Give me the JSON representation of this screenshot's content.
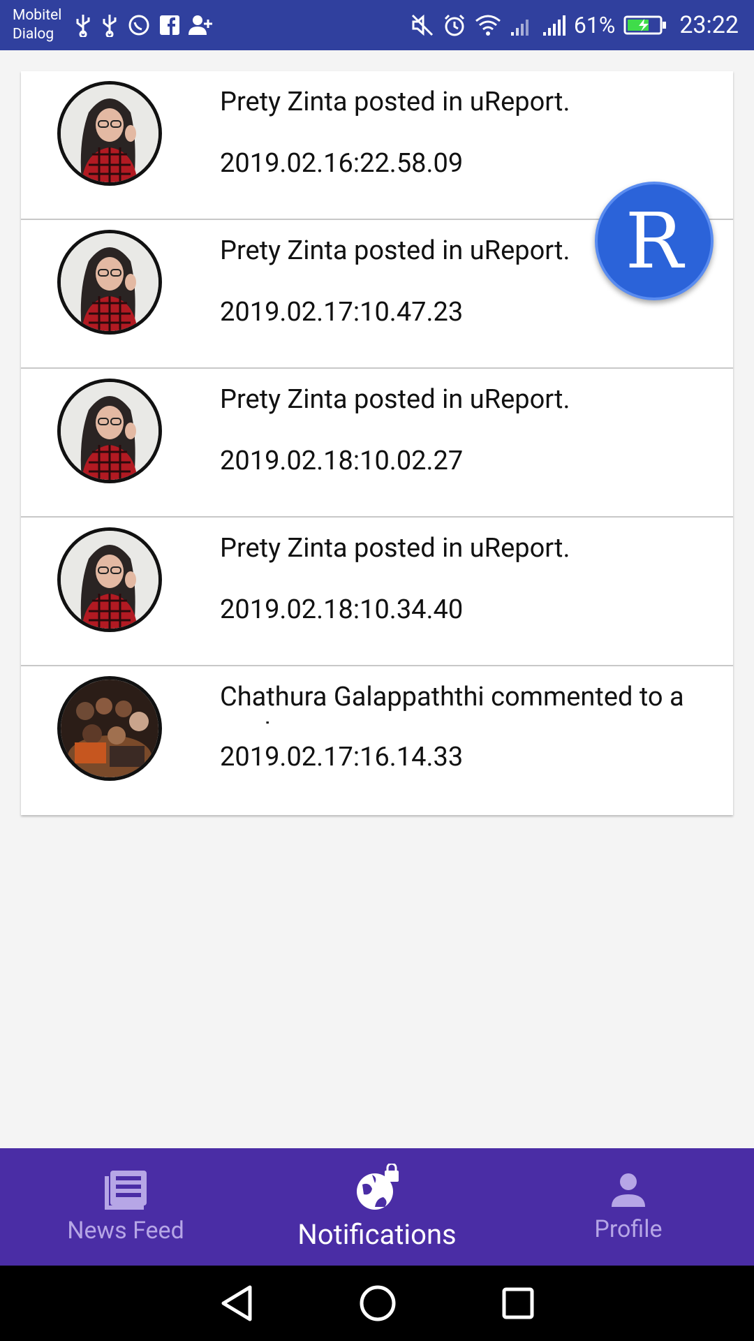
{
  "status_bar": {
    "carrier_1": "Mobitel",
    "carrier_2": "Dialog",
    "battery": "61%",
    "time": "23:22"
  },
  "notifications": [
    {
      "text": "Prety Zinta posted in uReport.",
      "time": "2019.02.16:22.58.09",
      "avatar": "woman-portrait"
    },
    {
      "text": "Prety Zinta posted in uReport.",
      "time": "2019.02.17:10.47.23",
      "avatar": "woman-portrait"
    },
    {
      "text": "Prety Zinta posted in uReport.",
      "time": "2019.02.18:10.02.27",
      "avatar": "woman-portrait"
    },
    {
      "text": "Prety Zinta posted in uReport.",
      "time": "2019.02.18:10.34.40",
      "avatar": "woman-portrait"
    },
    {
      "text": "Chathura Galappaththi commented to a post.",
      "time": "2019.02.17:16.14.33",
      "avatar": "group-photo"
    }
  ],
  "fab": {
    "label": "R"
  },
  "bottom_nav": {
    "items": [
      {
        "label": "News Feed",
        "icon": "newspaper-icon",
        "active": false
      },
      {
        "label": "Notifications",
        "icon": "globe-lock-icon",
        "active": true
      },
      {
        "label": "Profile",
        "icon": "person-icon",
        "active": false
      }
    ]
  },
  "colors": {
    "status_bar": "#30409e",
    "bottom_nav": "#4a2da5",
    "fab": "#2b63d9"
  }
}
